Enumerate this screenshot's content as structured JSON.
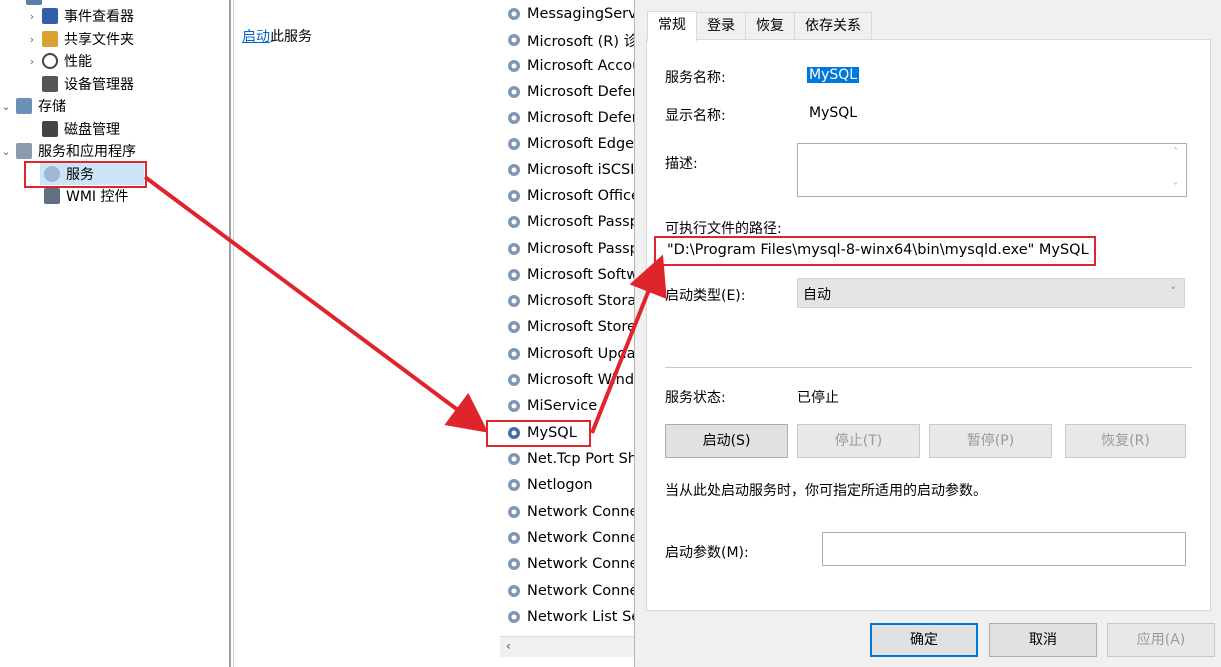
{
  "tree": {
    "items": [
      {
        "label": "事件查看器",
        "expand": "›",
        "icon": "event-viewer-icon"
      },
      {
        "label": "共享文件夹",
        "expand": "›",
        "icon": "shared-folder-icon"
      },
      {
        "label": "性能",
        "expand": "›",
        "icon": "performance-icon"
      },
      {
        "label": "设备管理器",
        "expand": "",
        "icon": "device-manager-icon"
      },
      {
        "label": "存储",
        "expand": "⌄",
        "icon": "storage-icon"
      },
      {
        "label": "磁盘管理",
        "expand": "",
        "icon": "disk-icon"
      },
      {
        "label": "服务和应用程序",
        "expand": "⌄",
        "icon": "services-apps-icon"
      },
      {
        "label": "服务",
        "expand": "",
        "icon": "services-icon"
      },
      {
        "label": "WMI 控件",
        "expand": "",
        "icon": "wmi-icon"
      }
    ]
  },
  "actions": {
    "start_link": "启动",
    "start_suffix": "此服务"
  },
  "services": [
    "MessagingServi",
    "Microsoft (R) 诊",
    "Microsoft Accou",
    "Microsoft Defer",
    "Microsoft Defer",
    "Microsoft Edge",
    "Microsoft iSCSI",
    "Microsoft Office",
    "Microsoft Passp",
    "Microsoft Passp",
    "Microsoft Softw",
    "Microsoft Storag",
    "Microsoft Store",
    "Microsoft Upda",
    "Microsoft Windo",
    "MiService",
    "MySQL",
    "Net.Tcp Port Sh",
    "Netlogon",
    "Network Conne",
    "Network Conne",
    "Network Conne",
    "Network Conne",
    "Network List Se"
  ],
  "dialog": {
    "tabs": [
      "常规",
      "登录",
      "恢复",
      "依存关系"
    ],
    "service_name_label": "服务名称:",
    "service_name": "MySQL",
    "display_name_label": "显示名称:",
    "display_name": "MySQL",
    "description_label": "描述:",
    "exe_path_label": "可执行文件的路径:",
    "exe_path": "\"D:\\Program Files\\mysql-8-winx64\\bin\\mysqld.exe\" MySQL",
    "startup_type_label": "启动类型(E):",
    "startup_type": "自动",
    "status_label": "服务状态:",
    "status": "已停止",
    "buttons": {
      "start": "启动(S)",
      "stop": "停止(T)",
      "pause": "暂停(P)",
      "resume": "恢复(R)"
    },
    "hint": "当从此处启动服务时，你可指定所适用的启动参数。",
    "param_label": "启动参数(M):",
    "param_value": "",
    "ok": "确定",
    "cancel": "取消",
    "apply": "应用(A)"
  },
  "colors": {
    "highlight": "#0078d7",
    "annotation": "#e0242b",
    "link": "#0066cc"
  }
}
